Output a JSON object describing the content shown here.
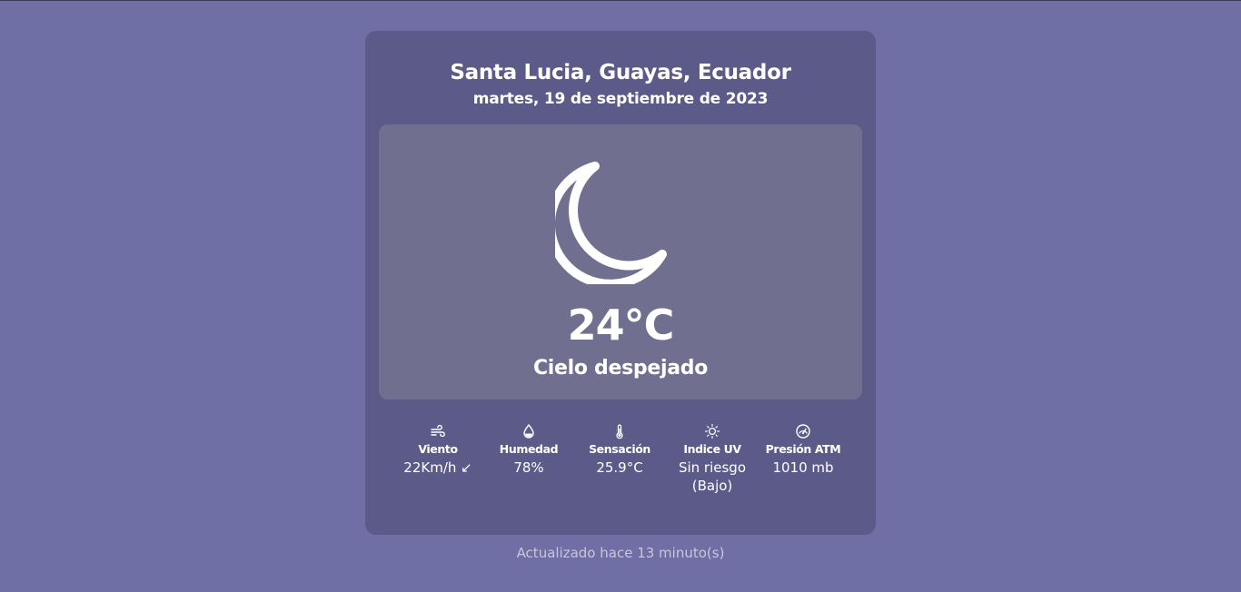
{
  "location": "Santa Lucia, Guayas, Ecuador",
  "date": "martes, 19 de septiembre de 2023",
  "current": {
    "icon": "moon-icon",
    "temperature": "24°C",
    "condition": "Cielo despejado"
  },
  "stats": [
    {
      "icon": "wind-icon",
      "label": "Viento",
      "value": "22Km/h ↙"
    },
    {
      "icon": "droplet-icon",
      "label": "Humedad",
      "value": "78%"
    },
    {
      "icon": "thermometer-icon",
      "label": "Sensación",
      "value": "25.9°C"
    },
    {
      "icon": "sun-icon",
      "label": "Indice UV",
      "value": "Sin riesgo (Bajo)"
    },
    {
      "icon": "gauge-icon",
      "label": "Presión ATM",
      "value": "1010 mb"
    }
  ],
  "updated": "Actualizado hace 13 minuto(s)",
  "colors": {
    "background": "#6f6ea5",
    "card": "#5b5a88",
    "panel": "#706f90",
    "muted_text": "#c9c6d9"
  }
}
